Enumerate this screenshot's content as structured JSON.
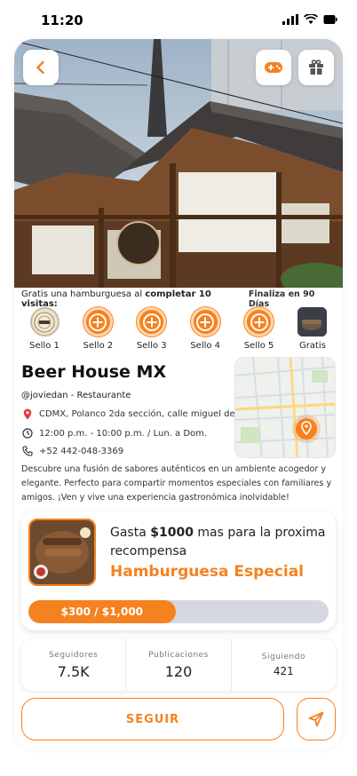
{
  "status_bar": {
    "time": "11:20"
  },
  "promo": {
    "text_before": "Gratis una hamburguesa al ",
    "text_bold": "completar 10 visitas:",
    "ends": "Finaliza en 90 Días"
  },
  "stamps": [
    {
      "label": "Sello 1",
      "state": "done"
    },
    {
      "label": "Sello 2",
      "state": "empty"
    },
    {
      "label": "Sello 3",
      "state": "empty"
    },
    {
      "label": "Sello 4",
      "state": "empty"
    },
    {
      "label": "Sello 5",
      "state": "empty"
    },
    {
      "label": "Gratis",
      "state": "free"
    }
  ],
  "venue": {
    "name": "Beer House MX",
    "handle": "@joviedan - Restaurante",
    "address": "CDMX, Polanco 2da sección, calle miguel de...",
    "hours": "12:00 p.m.  -  10:00 p.m. / Lun. a Dom.",
    "phone": "+52 442-048-3369",
    "description": "Descubre una fusión de sabores auténticos en un ambiente acogedor y elegante. Perfecto para compartir momentos especiales con familiares y amigos. ¡Ven y vive una experiencia gastronómica inolvidable!"
  },
  "reward": {
    "text_before": "Gasta ",
    "amount": "$1000",
    "text_after": " mas para la proxima recompensa",
    "title": "Hamburguesa Especial",
    "progress_label": "$300 / $1,000",
    "progress_fraction": 0.49
  },
  "stats": [
    {
      "label": "Seguidores",
      "value": "7.5K"
    },
    {
      "label": "Publicaciones",
      "value": "120"
    },
    {
      "label": "Siguiendo",
      "value": "421"
    }
  ],
  "actions": {
    "follow_label": "SEGUIR"
  },
  "colors": {
    "accent": "#f5821f",
    "track": "#d6d8df"
  },
  "icons": {
    "back": "chevron-left-icon",
    "game": "gamepad-icon",
    "gift": "gift-icon",
    "location": "location-pin-icon",
    "clock": "clock-icon",
    "phone": "phone-icon",
    "send": "send-icon"
  }
}
